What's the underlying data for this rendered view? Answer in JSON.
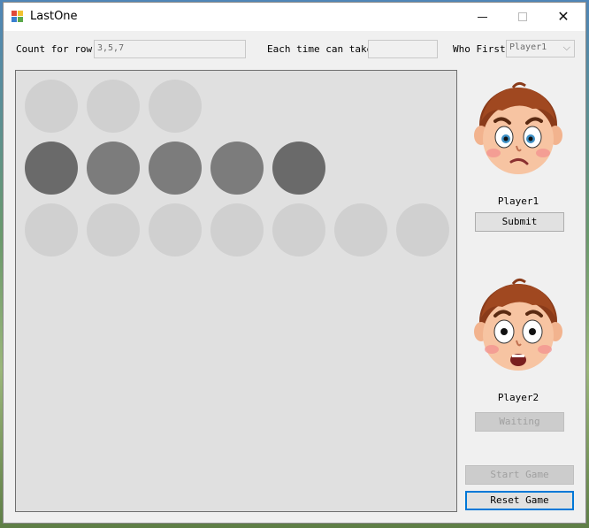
{
  "window": {
    "title": "LastOne"
  },
  "controls": {
    "count_label": "Count for row",
    "count_value": "3,5,7",
    "take_label": "Each time can take",
    "take_value": "",
    "first_label": "Who First",
    "first_value": "Player1"
  },
  "board": {
    "rows": [
      [
        "empty",
        "empty",
        "empty"
      ],
      [
        "dark",
        "selected",
        "selected",
        "selected",
        "dark"
      ],
      [
        "empty",
        "empty",
        "empty",
        "empty",
        "empty",
        "empty",
        "empty"
      ]
    ]
  },
  "players": [
    {
      "name": "Player1",
      "face": "worried-boy-face",
      "button": "Submit"
    },
    {
      "name": "Player2",
      "face": "scared-boy-face",
      "button": "Waiting"
    }
  ],
  "buttons": {
    "start": "Start Game",
    "reset": "Reset Game"
  },
  "colors": {
    "accent": "#0078d7",
    "board": "#e0e0e0",
    "ball_empty": "#d0d0d0",
    "ball_taken": "#7c7c7c"
  }
}
